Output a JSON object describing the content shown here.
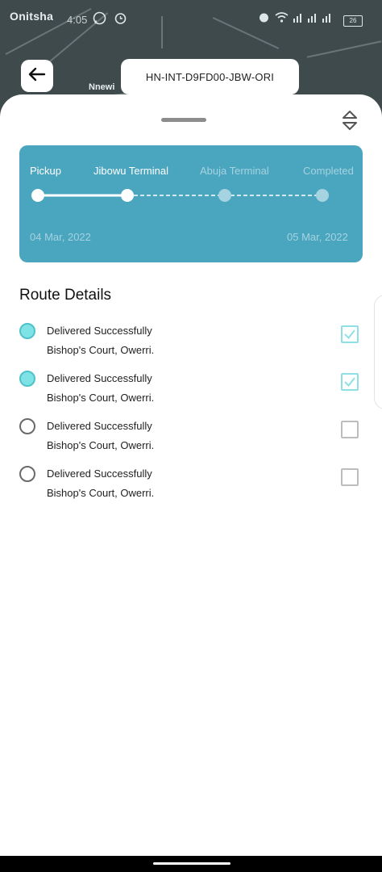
{
  "status_bar": {
    "city": "Onitsha",
    "time": "4:05",
    "battery": "26"
  },
  "map": {
    "label": "Nnewi"
  },
  "header": {
    "tracking_id": "HN-INT-D9FD00-JBW-ORI"
  },
  "progress": {
    "stages": [
      {
        "label": "Pickup",
        "state": "done"
      },
      {
        "label": "Jibowu Terminal",
        "state": "current"
      },
      {
        "label": "Abuja Terminal",
        "state": "pending"
      },
      {
        "label": "Completed",
        "state": "pending"
      }
    ],
    "start_date": "04 Mar, 2022",
    "end_date": "05 Mar, 2022",
    "colors": {
      "card": "#4aa5bf",
      "active": "#ffffff",
      "inactive": "#a5d3e0"
    }
  },
  "route": {
    "title": "Route Details",
    "items": [
      {
        "status": "Delivered Successfully",
        "address": "Bishop's Court, Owerri.",
        "done": true
      },
      {
        "status": "Delivered Successfully",
        "address": "Bishop's Court, Owerri.",
        "done": true
      },
      {
        "status": "Delivered Successfully",
        "address": "Bishop's Court, Owerri.",
        "done": false
      },
      {
        "status": "Delivered Successfully",
        "address": "Bishop's Court, Owerri.",
        "done": false
      }
    ]
  },
  "icons": {
    "back": "arrow-left-icon",
    "sort": "sort-icon",
    "whatsapp": "whatsapp-icon",
    "alarm": "alarm-icon",
    "wifi": "wifi-icon",
    "signal": "signal-icon"
  }
}
